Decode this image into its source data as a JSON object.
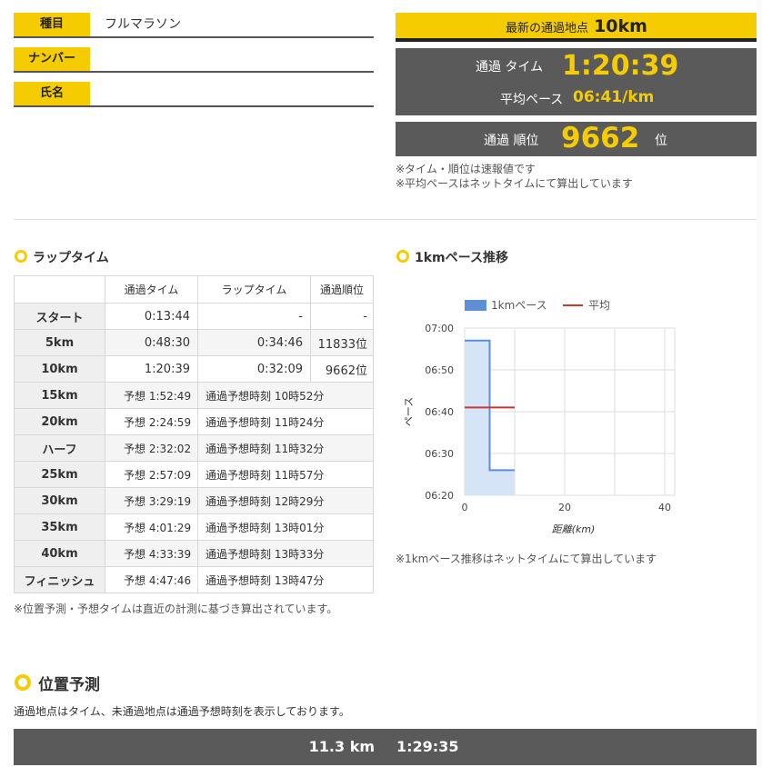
{
  "info": {
    "event_label": "種目",
    "event_value": "フルマラソン",
    "number_label": "ナンバー",
    "number_value": "",
    "name_label": "氏名",
    "name_value": ""
  },
  "latest": {
    "label": "最新の通過地点",
    "value": "10km"
  },
  "timing": {
    "pass_time_label": "通過 タイム",
    "pass_time": "1:20:39",
    "avg_pace_label": "平均ペース",
    "avg_pace": "06:41/km",
    "rank_label": "通過 順位",
    "rank": "9662",
    "rank_unit": "位"
  },
  "notes": {
    "note1": "※タイム・順位は速報値です",
    "note2": "※平均ペースはネットタイムにて算出しています",
    "lap_note": "※位置予測・予想タイムは直近の計測に基づき算出されています。",
    "pace_note": "※1kmペース推移はネットタイムにて算出しています",
    "prediction_desc": "通過地点はタイム、未通過地点は通過予想時刻を表示しております。"
  },
  "lap": {
    "title": "ラップタイム",
    "headers": [
      "",
      "通過タイム",
      "ラップタイム",
      "通過順位"
    ],
    "rows": [
      {
        "point": "スタート",
        "time": "0:13:44",
        "lap": "-",
        "rank": "-"
      },
      {
        "point": "5km",
        "time": "0:48:30",
        "lap": "0:34:46",
        "rank": "11833位"
      },
      {
        "point": "10km",
        "time": "1:20:39",
        "lap": "0:32:09",
        "rank": "9662位"
      },
      {
        "point": "15km",
        "time": "予想 1:52:49",
        "lap": "通過予想時刻 10時52分",
        "rank": ""
      },
      {
        "point": "20km",
        "time": "予想 2:24:59",
        "lap": "通過予想時刻 11時24分",
        "rank": ""
      },
      {
        "point": "ハーフ",
        "time": "予想 2:32:02",
        "lap": "通過予想時刻 11時32分",
        "rank": ""
      },
      {
        "point": "25km",
        "time": "予想 2:57:09",
        "lap": "通過予想時刻 11時57分",
        "rank": ""
      },
      {
        "point": "30km",
        "time": "予想 3:29:19",
        "lap": "通過予想時刻 12時29分",
        "rank": ""
      },
      {
        "point": "35km",
        "time": "予想 4:01:29",
        "lap": "通過予想時刻 13時01分",
        "rank": ""
      },
      {
        "point": "40km",
        "time": "予想 4:33:39",
        "lap": "通過予想時刻 13時33分",
        "rank": ""
      },
      {
        "point": "フィニッシュ",
        "time": "予想 4:47:46",
        "lap": "通過予想時刻 13時47分",
        "rank": ""
      }
    ]
  },
  "pace_chart_title": "1kmペース推移",
  "prediction": {
    "title": "位置予測",
    "distance": "11.3 km",
    "time": "1:29:35"
  },
  "colors": {
    "accent": "#f5cc00",
    "panel": "#5a5a5a",
    "pace_line": "#5b8fd6",
    "pace_fill": "#d6e4f7",
    "avg_line": "#cc3333"
  },
  "chart_data": {
    "type": "area",
    "title": "",
    "xlabel": "距離(km)",
    "ylabel": "ペース",
    "xlim": [
      0,
      42
    ],
    "ylim": [
      "06:20",
      "07:00"
    ],
    "xticks": [
      "0",
      "20",
      "40"
    ],
    "yticks": [
      "06:20",
      "06:30",
      "06:40",
      "06:50",
      "07:00"
    ],
    "legend": "top",
    "grid": true,
    "series": [
      {
        "name": "1kmペース",
        "x": [
          0,
          5,
          5,
          10
        ],
        "y": [
          "06:57",
          "06:57",
          "06:26",
          "06:26"
        ]
      },
      {
        "name": "平均",
        "x": [
          0,
          10
        ],
        "y": [
          "06:41",
          "06:41"
        ]
      }
    ]
  }
}
